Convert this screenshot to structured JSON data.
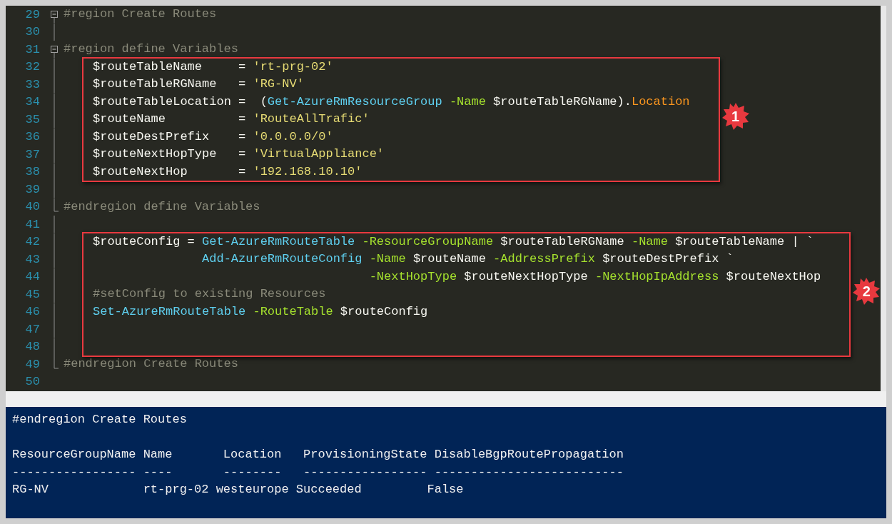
{
  "editor": {
    "blocks": [
      {
        "kind": "lines",
        "lines": [
          {
            "number": "29",
            "kind": "region_start",
            "tokens": [
              {
                "kind": "comment",
                "text": "#region Create Routes"
              }
            ]
          },
          {
            "number": "30",
            "kind": "inside"
          },
          {
            "number": "31",
            "kind": "region_start",
            "tokens": [
              {
                "kind": "comment",
                "text": "#region define Variables"
              }
            ]
          }
        ]
      },
      {
        "kind": "callout",
        "badge": "1",
        "lines": [
          {
            "number": "32",
            "kind": "inside",
            "tokens": [
              {
                "kind": "plain",
                "text": "$routeTableName     = "
              },
              {
                "kind": "string",
                "text": "'rt-prg-02'"
              }
            ]
          },
          {
            "number": "33",
            "kind": "inside",
            "tokens": [
              {
                "kind": "plain",
                "text": "$routeTableRGName   = "
              },
              {
                "kind": "string",
                "text": "'RG-NV'"
              }
            ]
          },
          {
            "number": "34",
            "kind": "inside",
            "tokens": [
              {
                "kind": "plain",
                "text": "$routeTableLocation =  ("
              },
              {
                "kind": "cmdlet",
                "text": "Get-AzureRmResourceGroup "
              },
              {
                "kind": "param",
                "text": "-Name"
              },
              {
                "kind": "plain",
                "text": " $routeTableRGName)."
              },
              {
                "kind": "property",
                "text": "Location"
              }
            ]
          },
          {
            "number": "35",
            "kind": "inside",
            "tokens": [
              {
                "kind": "plain",
                "text": "$routeName          = "
              },
              {
                "kind": "string",
                "text": "'RouteAllTrafic'"
              }
            ]
          },
          {
            "number": "36",
            "kind": "inside",
            "tokens": [
              {
                "kind": "plain",
                "text": "$routeDestPrefix    = "
              },
              {
                "kind": "string",
                "text": "'0.0.0.0/0'"
              }
            ]
          },
          {
            "number": "37",
            "kind": "inside",
            "tokens": [
              {
                "kind": "plain",
                "text": "$routeNextHopType   = "
              },
              {
                "kind": "string",
                "text": "'VirtualAppliance'"
              }
            ]
          },
          {
            "number": "38",
            "kind": "inside",
            "tokens": [
              {
                "kind": "plain",
                "text": "$routeNextHop       = "
              },
              {
                "kind": "string",
                "text": "'192.168.10.10'"
              }
            ]
          }
        ]
      },
      {
        "kind": "lines",
        "lines": [
          {
            "number": "39",
            "kind": "inside"
          },
          {
            "number": "40",
            "kind": "region_end",
            "tokens": [
              {
                "kind": "comment",
                "text": "#endregion define Variables"
              }
            ]
          },
          {
            "number": "41",
            "kind": "inside"
          }
        ]
      },
      {
        "kind": "callout",
        "badge": "2",
        "lines": [
          {
            "number": "42",
            "kind": "inside",
            "tokens": [
              {
                "kind": "plain",
                "text": "$routeConfig = "
              },
              {
                "kind": "cmdlet",
                "text": "Get-AzureRmRouteTable "
              },
              {
                "kind": "param",
                "text": "-ResourceGroupName"
              },
              {
                "kind": "plain",
                "text": " $routeTableRGName "
              },
              {
                "kind": "param",
                "text": "-Name"
              },
              {
                "kind": "plain",
                "text": " $routeTableName | `"
              }
            ]
          },
          {
            "number": "43",
            "kind": "inside",
            "tokens": [
              {
                "kind": "cmdlet",
                "text": "               Add-AzureRmRouteConfig "
              },
              {
                "kind": "param",
                "text": "-Name"
              },
              {
                "kind": "plain",
                "text": " $routeName "
              },
              {
                "kind": "param",
                "text": "-AddressPrefix"
              },
              {
                "kind": "plain",
                "text": " $routeDestPrefix `"
              }
            ]
          },
          {
            "number": "44",
            "kind": "inside",
            "tokens": [
              {
                "kind": "param",
                "text": "                                      -NextHopType"
              },
              {
                "kind": "plain",
                "text": " $routeNextHopType "
              },
              {
                "kind": "param",
                "text": "-NextHopIpAddress"
              },
              {
                "kind": "plain",
                "text": " $routeNextHop"
              }
            ]
          },
          {
            "number": "45",
            "kind": "inside",
            "tokens": [
              {
                "kind": "comment",
                "text": "#setConfig to existing Resources"
              }
            ]
          },
          {
            "number": "46",
            "kind": "inside",
            "tokens": [
              {
                "kind": "cmdlet",
                "text": "Set-AzureRmRouteTable "
              },
              {
                "kind": "param",
                "text": "-RouteTable"
              },
              {
                "kind": "plain",
                "text": " $routeConfig"
              }
            ]
          },
          {
            "number": "47",
            "kind": "inside"
          },
          {
            "number": "48",
            "kind": "inside"
          }
        ]
      },
      {
        "kind": "lines",
        "lines": [
          {
            "number": "49",
            "kind": "region_end",
            "tokens": [
              {
                "kind": "comment",
                "text": "#endregion Create Routes"
              }
            ]
          },
          {
            "number": "50",
            "kind": "outside"
          }
        ]
      }
    ]
  },
  "console": {
    "paragraphs": [
      [
        "#endregion Create Routes"
      ],
      [
        "ResourceGroupName Name       Location   ProvisioningState DisableBgpRoutePropagation",
        "----------------- ----       --------   ----------------- --------------------------",
        "RG-NV             rt-prg-02 westeurope Succeeded         False"
      ]
    ]
  }
}
